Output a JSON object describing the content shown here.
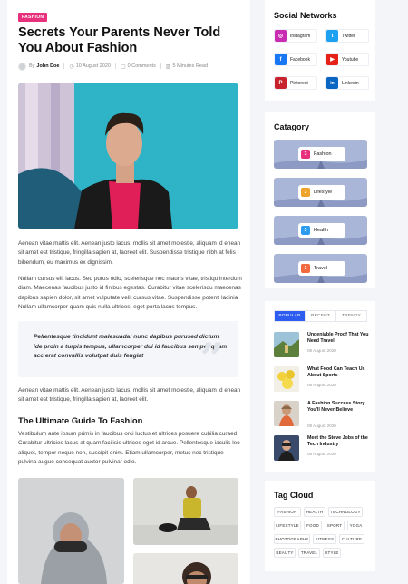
{
  "article": {
    "category": "FASHION",
    "title": "Secrets Your Parents Never Told You About Fashion",
    "meta": {
      "by": "By",
      "author": "John Doe",
      "date": "10 August 2020",
      "comments": "0 Comments",
      "read_time": "5 Minutes Read"
    },
    "paragraph_1": "Aenean vitae mattis elit.  Aenean justo lacus, mollis sit amet molestie, aliquam id enean sit amet est tristique, fringilla sapien at, laoreet elit. Suspendisse tristique nibh at felis bibendum, eu maximus ex dignissim.",
    "paragraph_2": "Nullam cursus elit lacus. Sed purus odio, scelerisque nec mauris vitae, tristiqu interdum diam. Maecenas faucibus justo id finibus egestas. Curabitur vitae scelerisqu maecenas dapibus sapien dolor, sit amet vulputate velit cursus vitae. Suspendisse potenti lacinia Nullam ullamcorper quam quis nulla ultrices, eget porta lacus tempus.",
    "quote": "Pellentesque tincidunt malesuada! nunc dapibus purused dictum ide proin a turpis tempus, ullamcorper dui id faucibus semper quam acc erat convallis volutpat duis feugiat",
    "paragraph_3": "Aenean vitae mattis elit.  Aenean justo lacus, mollis sit amet molestie, aliquam id enean sit amet est tristique, fringilla sapien at, laoreet elit.",
    "subheading": "The Ultimate Guide To Fashion",
    "paragraph_4": " Vestibulum ante ipsum primis in faucibus orci luctus et ultrices posuere cubilia curaed Curabitur ultricies lacus at quam facilisis ultrices eget id arcue. Pellentesque iaculis leo aliquet, tempor neque non, suscipit enim. Etiam ullamcorper, metus nec tristique pulvina augue consequat auctor pulvinar odio."
  },
  "sidebar": {
    "social": {
      "title": "Social Networks",
      "items": [
        {
          "label": "Instagram",
          "icon": "instagram-icon",
          "color": "#c92bb1",
          "glyph": "◎"
        },
        {
          "label": "Twitter",
          "icon": "twitter-icon",
          "color": "#1da1f2",
          "glyph": "t"
        },
        {
          "label": "Facebook",
          "icon": "facebook-icon",
          "color": "#1877f2",
          "glyph": "f"
        },
        {
          "label": "Youtube",
          "icon": "youtube-icon",
          "color": "#e62117",
          "glyph": "▶"
        },
        {
          "label": "Pinterest",
          "icon": "pinterest-icon",
          "color": "#c8232c",
          "glyph": "P"
        },
        {
          "label": "Linkedin",
          "icon": "linkedin-icon",
          "color": "#0a66c2",
          "glyph": "in"
        }
      ]
    },
    "category": {
      "title": "Catagory",
      "items": [
        {
          "label": "Fashion",
          "num": "3",
          "color": "#e8317c"
        },
        {
          "label": "Lifestyle",
          "num": "3",
          "color": "#f0a32a"
        },
        {
          "label": "Health",
          "num": "3",
          "color": "#2d9cf0"
        },
        {
          "label": "Travel",
          "num": "3",
          "color": "#f26a3d"
        }
      ]
    },
    "posts": {
      "tabs": [
        "POPULAR",
        "RECENT",
        "TRENDY"
      ],
      "active_tab": "POPULAR",
      "items": [
        {
          "title": "Undeniable Proof That You Need Travel",
          "date": "08 August 2020"
        },
        {
          "title": "What Food Can Teach Us About Sports",
          "date": "08 August 2020"
        },
        {
          "title": "A Fashion Success Story You'll Never Believe",
          "date": "08 August 2020"
        },
        {
          "title": "Meet the Steve Jobs of the Tech Industry",
          "date": "08 August 2020"
        }
      ]
    },
    "tags": {
      "title": "Tag Cloud",
      "items": [
        "FASHION",
        "HEALTH",
        "TECHNOLOGY",
        "LIFESTYLE",
        "FOOD",
        "SPORT",
        "YOGA",
        "PHOTOGRAPHY",
        "FITNESS",
        "CULTURE",
        "BEAUTY",
        "TRAVEL",
        "STYLE"
      ]
    }
  },
  "colors": {
    "accent_blue": "#2d5cf0",
    "category_pink": "#e8317c",
    "hero_teal": "#2fb3c6"
  }
}
